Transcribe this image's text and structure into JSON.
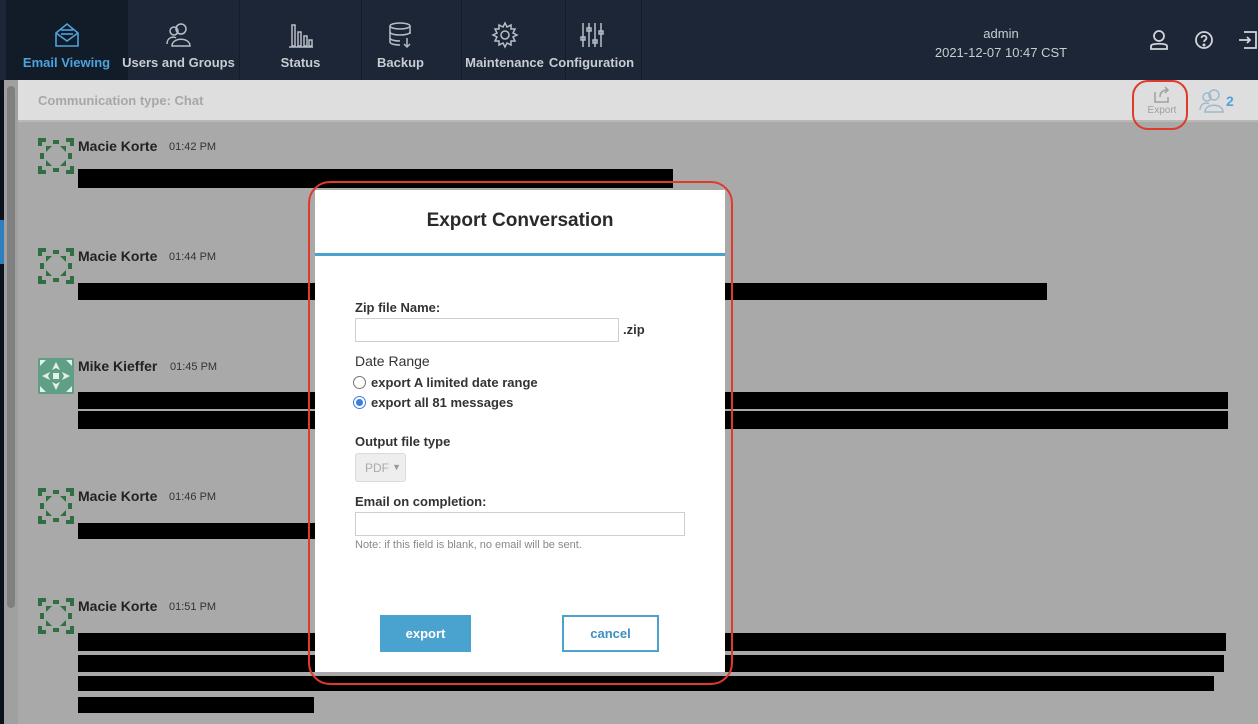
{
  "nav": {
    "items": [
      {
        "label": "Email Viewing",
        "icon": "envelope-icon",
        "active": true
      },
      {
        "label": "Users and Groups",
        "icon": "users-icon"
      },
      {
        "label": "Status",
        "icon": "bar-chart-icon"
      },
      {
        "label": "Backup",
        "icon": "database-icon"
      },
      {
        "label": "Maintenance",
        "icon": "gear-icon"
      },
      {
        "label": "Configuration",
        "icon": "sliders-icon"
      }
    ],
    "user": "admin",
    "datetime": "2021-12-07 10:47 CST"
  },
  "conversation": {
    "comm_type": "Communication type: Chat",
    "export_label": "Export",
    "participant_count": "2",
    "messages": [
      {
        "name": "Macie Korte",
        "time": "01:42 PM"
      },
      {
        "name": "Macie Korte",
        "time": "01:44 PM"
      },
      {
        "name": "Mike Kieffer",
        "time": "01:45 PM"
      },
      {
        "name": "Macie Korte",
        "time": "01:46 PM"
      },
      {
        "name": "Macie Korte",
        "time": "01:51 PM"
      }
    ]
  },
  "modal": {
    "title": "Export Conversation",
    "zip_label": "Zip file Name:",
    "zip_value": "",
    "zip_ext": ".zip",
    "date_range_label": "Date Range",
    "radio_limited": "export A limited date range",
    "radio_all": "export all 81 messages",
    "selected_range": "all",
    "output_type_label": "Output file type",
    "output_type_value": "PDF",
    "email_label": "Email on completion:",
    "email_value": "",
    "note": "Note: if this field is blank, no email will be sent.",
    "export_button": "export",
    "cancel_button": "cancel"
  },
  "colors": {
    "accent": "#4aa3cf",
    "highlight": "#e03a2c",
    "nav_bg": "#1d2636"
  }
}
